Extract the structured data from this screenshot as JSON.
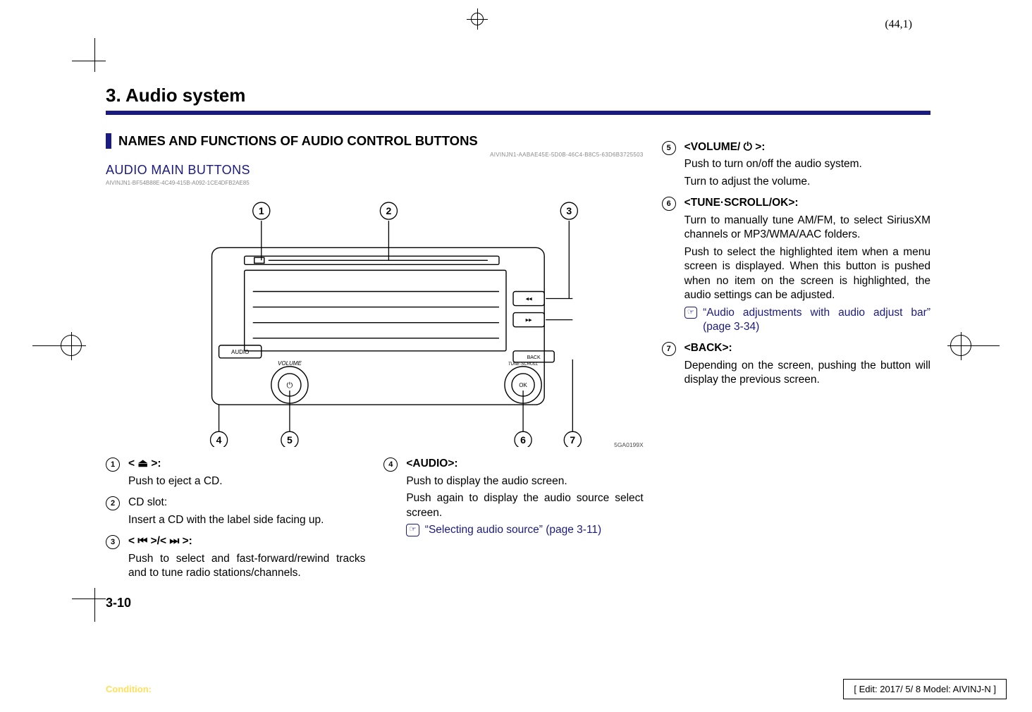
{
  "page_ref": "(44,1)",
  "chapter_title": "3. Audio system",
  "section_title": "NAMES AND FUNCTIONS OF AUDIO CONTROL BUTTONS",
  "section_code": "AIVINJN1-AABAE45E-5D0B-46C4-B8C5-63D6B3725503",
  "subsection_title": "AUDIO MAIN BUTTONS",
  "subsection_code": "AIVINJN1-BF54B88E-4C49-415B-A092-1CE4DFB2AE85",
  "diagram": {
    "callouts": [
      "1",
      "2",
      "3",
      "4",
      "5",
      "6",
      "7"
    ],
    "panel_labels": [
      "AUDIO",
      "VOLUME",
      "TUNE·SCROLL",
      "OK",
      "BACK"
    ],
    "track_icons": [
      "◂◂",
      "▸▸"
    ],
    "image_code": "5GA0199X"
  },
  "items": [
    {
      "n": "1",
      "label_prefix": "< ",
      "label_glyph": "⏏",
      "label_suffix": " >:",
      "desc": "Push to eject a CD."
    },
    {
      "n": "2",
      "label": "CD slot:",
      "desc": "Insert a CD with the label side facing up."
    },
    {
      "n": "3",
      "label_prefix": "< ",
      "label_glyph": "⏮",
      "label_mid": " >/< ",
      "label_glyph2": "⏭",
      "label_suffix": " >:",
      "desc": "Push to select and fast-forward/rewind tracks and to tune radio stations/channels."
    },
    {
      "n": "4",
      "label": "<AUDIO>:",
      "desc": "Push to display the audio screen.",
      "desc2": "Push again to display the audio source select screen.",
      "ref": "“Selecting audio source” (page 3-11)"
    },
    {
      "n": "5",
      "label_prefix": "<VOLUME/ ",
      "label_glyph": "⏻",
      "label_suffix": " >:",
      "desc": "Push to turn on/off the audio system.",
      "desc2": "Turn to adjust the volume."
    },
    {
      "n": "6",
      "label": "<TUNE·SCROLL/OK>:",
      "desc": "Turn to manually tune AM/FM, to select SiriusXM channels or MP3/WMA/AAC folders.",
      "desc2": "Push to select the highlighted item when a menu screen is displayed. When this button is pushed when no item on the screen is highlighted, the audio settings can be adjusted.",
      "ref": "“Audio adjustments with audio adjust bar” (page 3-34)"
    },
    {
      "n": "7",
      "label": "<BACK>:",
      "desc": "Depending on the screen, pushing the button will display the previous screen."
    }
  ],
  "page_number": "3-10",
  "footer": {
    "condition_label": "Condition:",
    "edit_info": "[ Edit: 2017/ 5/ 8   Model:  AIVINJ-N ]"
  },
  "ref_icon_text": "☞"
}
